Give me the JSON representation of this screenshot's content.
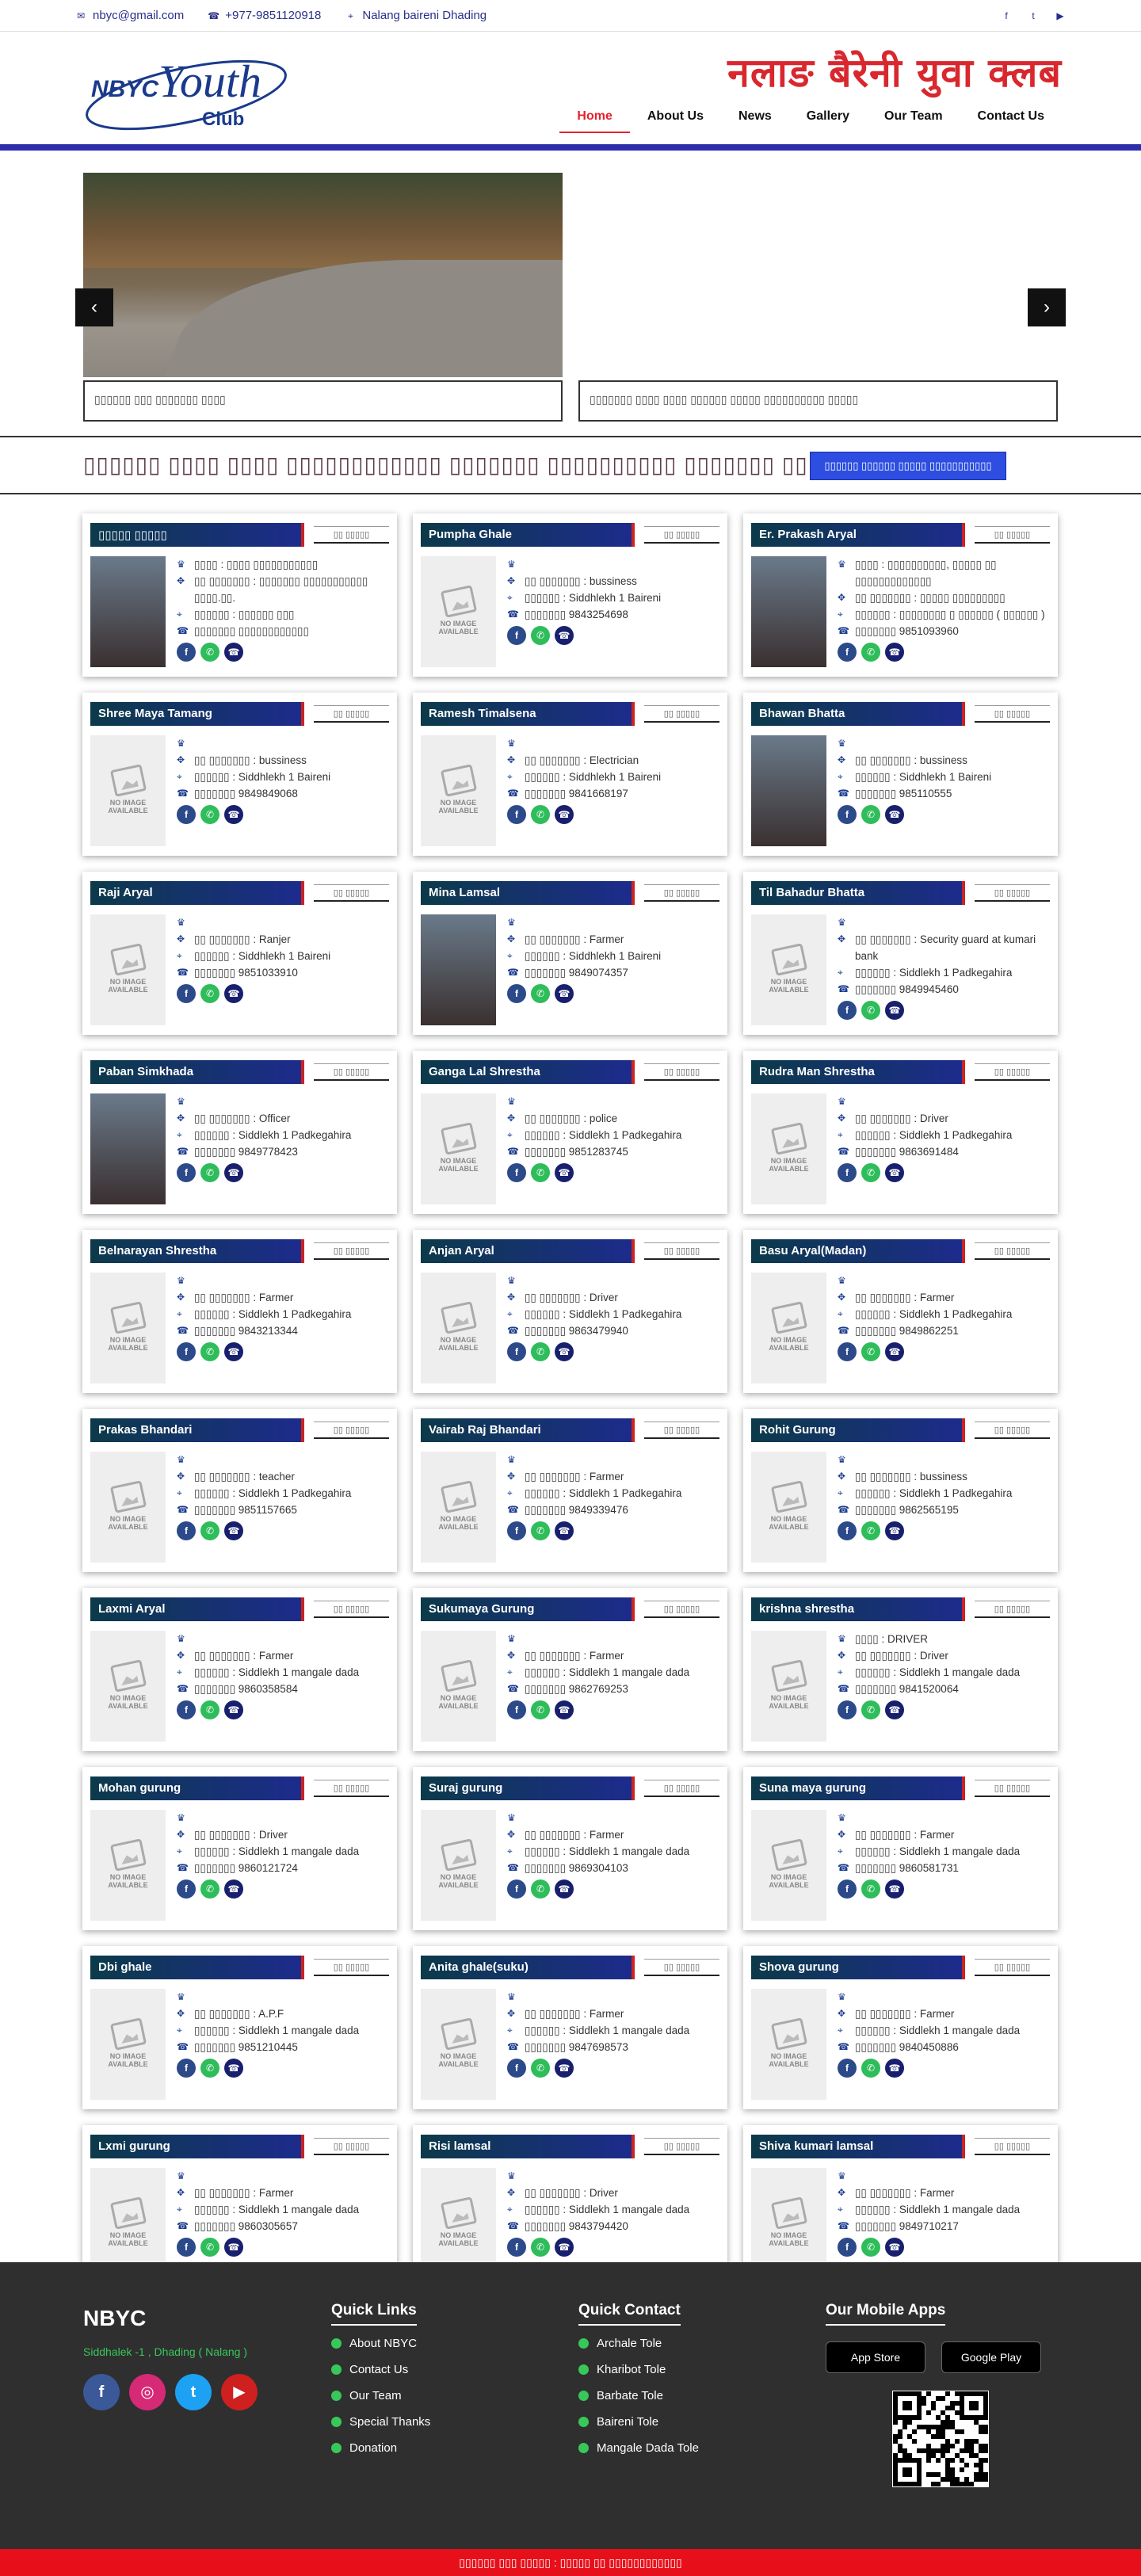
{
  "topbar": {
    "email": "nbyc@gmail.com",
    "phone": "+977-9851120918",
    "address": "Nalang baireni Dhading"
  },
  "header": {
    "brand": "नलाङ बैरेनी युवा क्लब",
    "logo_text": "NBYC Youth",
    "logo_sub": "Club",
    "nav": [
      "Home",
      "About Us",
      "News",
      "Gallery",
      "Our Team",
      "Contact Us"
    ]
  },
  "slider": {
    "caption1": "▯▯▯▯▯▯ ▯▯▯ ▯▯▯▯▯▯▯ ▯▯▯▯",
    "caption2": "▯▯▯▯▯▯▯ ▯▯▯▯ ▯▯▯▯ ▯▯▯▯▯▯ ▯▯▯▯▯ ▯▯▯▯▯▯▯▯▯▯ ▯▯▯▯▯",
    "prev": "‹",
    "next": "›"
  },
  "notice": {
    "text": "▯▯▯▯▯▯ ▯▯▯▯ ▯▯▯▯ ▯▯▯▯▯▯▯▯▯▯▯▯ ▯▯▯▯▯▯▯ ▯▯▯▯▯▯▯▯▯▯ ▯▯▯▯▯▯▯ ▯▯▯▯▯",
    "button": "▯▯▯▯▯▯ ▯▯▯▯▯▯ ▯▯▯▯▯ ▯▯▯▯▯▯▯▯▯▯▯"
  },
  "tag": "▯▯ ▯▯▯▯▯",
  "no_image": "NO IMAGE AVAILABLE",
  "members": [
    {
      "name": "▯▯▯▯▯ ▯▯▯▯▯",
      "photo": true,
      "role": "▯▯▯▯ : ▯▯▯▯ ▯▯▯▯▯▯▯▯▯▯▯",
      "job": "▯▯ ▯▯▯▯▯▯▯ : ▯▯▯▯▯▯▯ ▯▯▯▯▯▯▯▯▯▯▯ ▯▯▯▯.▯▯.",
      "addr": "▯▯▯▯▯▯ : ▯▯▯▯▯▯ ▯▯▯",
      "phone": "▯▯▯▯▯▯▯ ▯▯▯▯▯▯▯▯▯▯▯▯"
    },
    {
      "name": "Pumpha Ghale",
      "photo": false,
      "role": "",
      "job": "▯▯ ▯▯▯▯▯▯▯ : bussiness",
      "addr": "▯▯▯▯▯▯ : Siddhlekh 1 Baireni",
      "phone": "▯▯▯▯▯▯▯ 9843254698"
    },
    {
      "name": "Er. Prakash Aryal",
      "photo": true,
      "role": "▯▯▯▯ : ▯▯▯▯▯▯▯▯▯▯, ▯▯▯▯▯ ▯▯ ▯▯▯▯▯▯▯▯▯▯▯▯▯",
      "job": "▯▯ ▯▯▯▯▯▯▯ : ▯▯▯▯▯ ▯▯▯▯▯▯▯▯▯",
      "addr": "▯▯▯▯▯▯ : ▯▯▯▯▯▯▯▯ ▯ ▯▯▯▯▯▯ ( ▯▯▯▯▯▯ )",
      "phone": "▯▯▯▯▯▯▯ 9851093960"
    },
    {
      "name": "Shree Maya Tamang",
      "photo": false,
      "role": "",
      "job": "▯▯ ▯▯▯▯▯▯▯ : bussiness",
      "addr": "▯▯▯▯▯▯ : Siddhlekh 1 Baireni",
      "phone": "▯▯▯▯▯▯▯ 9849849068"
    },
    {
      "name": "Ramesh Timalsena",
      "photo": false,
      "role": "",
      "job": "▯▯ ▯▯▯▯▯▯▯ : Electrician",
      "addr": "▯▯▯▯▯▯ : Siddhlekh 1 Baireni",
      "phone": "▯▯▯▯▯▯▯ 9841668197"
    },
    {
      "name": "Bhawan Bhatta",
      "photo": true,
      "role": "",
      "job": "▯▯ ▯▯▯▯▯▯▯ : bussiness",
      "addr": "▯▯▯▯▯▯ : Siddhlekh 1 Baireni",
      "phone": "▯▯▯▯▯▯▯ 985110555"
    },
    {
      "name": "Raji Aryal",
      "photo": false,
      "role": "",
      "job": "▯▯ ▯▯▯▯▯▯▯ : Ranjer",
      "addr": "▯▯▯▯▯▯ : Siddhlekh 1 Baireni",
      "phone": "▯▯▯▯▯▯▯ 9851033910"
    },
    {
      "name": "Mina Lamsal",
      "photo": true,
      "role": "",
      "job": "▯▯ ▯▯▯▯▯▯▯ : Farmer",
      "addr": "▯▯▯▯▯▯ : Siddhlekh 1 Baireni",
      "phone": "▯▯▯▯▯▯▯ 9849074357"
    },
    {
      "name": "Til Bahadur Bhatta",
      "photo": false,
      "role": "",
      "job": "▯▯ ▯▯▯▯▯▯▯ : Security guard at kumari bank",
      "addr": "▯▯▯▯▯▯ : Siddlekh 1 Padkegahira",
      "phone": "▯▯▯▯▯▯▯ 9849945460"
    },
    {
      "name": "Paban Simkhada",
      "photo": true,
      "role": "",
      "job": "▯▯ ▯▯▯▯▯▯▯ : Officer",
      "addr": "▯▯▯▯▯▯ : Siddlekh 1 Padkegahira",
      "phone": "▯▯▯▯▯▯▯ 9849778423"
    },
    {
      "name": "Ganga Lal Shrestha",
      "photo": false,
      "role": "",
      "job": "▯▯ ▯▯▯▯▯▯▯ : police",
      "addr": "▯▯▯▯▯▯ : Siddlekh 1 Padkegahira",
      "phone": "▯▯▯▯▯▯▯ 9851283745"
    },
    {
      "name": "Rudra Man Shrestha",
      "photo": false,
      "role": "",
      "job": "▯▯ ▯▯▯▯▯▯▯ : Driver",
      "addr": "▯▯▯▯▯▯ : Siddlekh 1 Padkegahira",
      "phone": "▯▯▯▯▯▯▯ 9863691484"
    },
    {
      "name": "Belnarayan Shrestha",
      "photo": false,
      "role": "",
      "job": "▯▯ ▯▯▯▯▯▯▯ : Farmer",
      "addr": "▯▯▯▯▯▯ : Siddlekh 1 Padkegahira",
      "phone": "▯▯▯▯▯▯▯ 9843213344"
    },
    {
      "name": "Anjan Aryal",
      "photo": false,
      "role": "",
      "job": "▯▯ ▯▯▯▯▯▯▯ : Driver",
      "addr": "▯▯▯▯▯▯ : Siddlekh 1 Padkegahira",
      "phone": "▯▯▯▯▯▯▯ 9863479940"
    },
    {
      "name": "Basu Aryal(Madan)",
      "photo": false,
      "role": "",
      "job": "▯▯ ▯▯▯▯▯▯▯ : Farmer",
      "addr": "▯▯▯▯▯▯ : Siddlekh 1 Padkegahira",
      "phone": "▯▯▯▯▯▯▯ 9849862251"
    },
    {
      "name": "Prakas Bhandari",
      "photo": false,
      "role": "",
      "job": "▯▯ ▯▯▯▯▯▯▯ : teacher",
      "addr": "▯▯▯▯▯▯ : Siddlekh 1 Padkegahira",
      "phone": "▯▯▯▯▯▯▯ 9851157665"
    },
    {
      "name": "Vairab Raj Bhandari",
      "photo": false,
      "role": "",
      "job": "▯▯ ▯▯▯▯▯▯▯ : Farmer",
      "addr": "▯▯▯▯▯▯ : Siddlekh 1 Padkegahira",
      "phone": "▯▯▯▯▯▯▯ 9849339476"
    },
    {
      "name": "Rohit Gurung",
      "photo": false,
      "role": "",
      "job": "▯▯ ▯▯▯▯▯▯▯ : bussiness",
      "addr": "▯▯▯▯▯▯ : Siddlekh 1 Padkegahira",
      "phone": "▯▯▯▯▯▯▯ 9862565195"
    },
    {
      "name": "Laxmi Aryal",
      "photo": false,
      "role": "",
      "job": "▯▯ ▯▯▯▯▯▯▯ : Farmer",
      "addr": "▯▯▯▯▯▯ : Siddlekh 1 mangale dada",
      "phone": "▯▯▯▯▯▯▯ 9860358584"
    },
    {
      "name": "Sukumaya Gurung",
      "photo": false,
      "role": "",
      "job": "▯▯ ▯▯▯▯▯▯▯ : Farmer",
      "addr": "▯▯▯▯▯▯ : Siddlekh 1 mangale dada",
      "phone": "▯▯▯▯▯▯▯ 9862769253"
    },
    {
      "name": "krishna shrestha",
      "photo": false,
      "role": "▯▯▯▯ : DRIVER",
      "job": "▯▯ ▯▯▯▯▯▯▯ : Driver",
      "addr": "▯▯▯▯▯▯ : Siddlekh 1 mangale dada",
      "phone": "▯▯▯▯▯▯▯ 9841520064"
    },
    {
      "name": "Mohan gurung",
      "photo": false,
      "role": "",
      "job": "▯▯ ▯▯▯▯▯▯▯ : Driver",
      "addr": "▯▯▯▯▯▯ : Siddlekh 1 mangale dada",
      "phone": "▯▯▯▯▯▯▯ 9860121724"
    },
    {
      "name": "Suraj gurung",
      "photo": false,
      "role": "",
      "job": "▯▯ ▯▯▯▯▯▯▯ : Farmer",
      "addr": "▯▯▯▯▯▯ : Siddlekh 1 mangale dada",
      "phone": "▯▯▯▯▯▯▯ 9869304103"
    },
    {
      "name": "Suna maya gurung",
      "photo": false,
      "role": "",
      "job": "▯▯ ▯▯▯▯▯▯▯ : Farmer",
      "addr": "▯▯▯▯▯▯ : Siddlekh 1 mangale dada",
      "phone": "▯▯▯▯▯▯▯ 9860581731"
    },
    {
      "name": "Dbi ghale",
      "photo": false,
      "role": "",
      "job": "▯▯ ▯▯▯▯▯▯▯ : A.P.F",
      "addr": "▯▯▯▯▯▯ : Siddlekh 1 mangale dada",
      "phone": "▯▯▯▯▯▯▯ 9851210445"
    },
    {
      "name": "Anita ghale(suku)",
      "photo": false,
      "role": "",
      "job": "▯▯ ▯▯▯▯▯▯▯ : Farmer",
      "addr": "▯▯▯▯▯▯ : Siddlekh 1 mangale dada",
      "phone": "▯▯▯▯▯▯▯ 9847698573"
    },
    {
      "name": "Shova gurung",
      "photo": false,
      "role": "",
      "job": "▯▯ ▯▯▯▯▯▯▯ : Farmer",
      "addr": "▯▯▯▯▯▯ : Siddlekh 1 mangale dada",
      "phone": "▯▯▯▯▯▯▯ 9840450886"
    },
    {
      "name": "Lxmi gurung",
      "photo": false,
      "role": "",
      "job": "▯▯ ▯▯▯▯▯▯▯ : Farmer",
      "addr": "▯▯▯▯▯▯ : Siddlekh 1 mangale dada",
      "phone": "▯▯▯▯▯▯▯ 9860305657"
    },
    {
      "name": "Risi lamsal",
      "photo": false,
      "role": "",
      "job": "▯▯ ▯▯▯▯▯▯▯ : Driver",
      "addr": "▯▯▯▯▯▯ : Siddlekh 1 mangale dada",
      "phone": "▯▯▯▯▯▯▯ 9843794420"
    },
    {
      "name": "Shiva kumari lamsal",
      "photo": false,
      "role": "",
      "job": "▯▯ ▯▯▯▯▯▯▯ : Farmer",
      "addr": "▯▯▯▯▯▯ : Siddlekh 1 mangale dada",
      "phone": "▯▯▯▯▯▯▯ 9849710217"
    }
  ],
  "footer": {
    "title": "NBYC",
    "address": "Siddhalek -1 , Dhading ( Nalang )",
    "quick_links_title": "Quick Links",
    "quick_links": [
      "About NBYC",
      "Contact Us",
      "Our Team",
      "Special Thanks",
      "Donation"
    ],
    "quick_contact_title": "Quick Contact",
    "quick_contact": [
      "Archale Tole",
      "Kharibot Tole",
      "Barbate Tole",
      "Baireni Tole",
      "Mangale Dada Tole"
    ],
    "apps_title": "Our Mobile Apps",
    "app_store": "App Store",
    "google_play": "Google Play"
  },
  "bottombar": "▯▯▯▯▯▯ ▯▯▯ ▯▯▯▯▯ : ▯▯▯▯▯ ▯▯ ▯▯▯▯▯▯▯▯▯▯▯▯"
}
